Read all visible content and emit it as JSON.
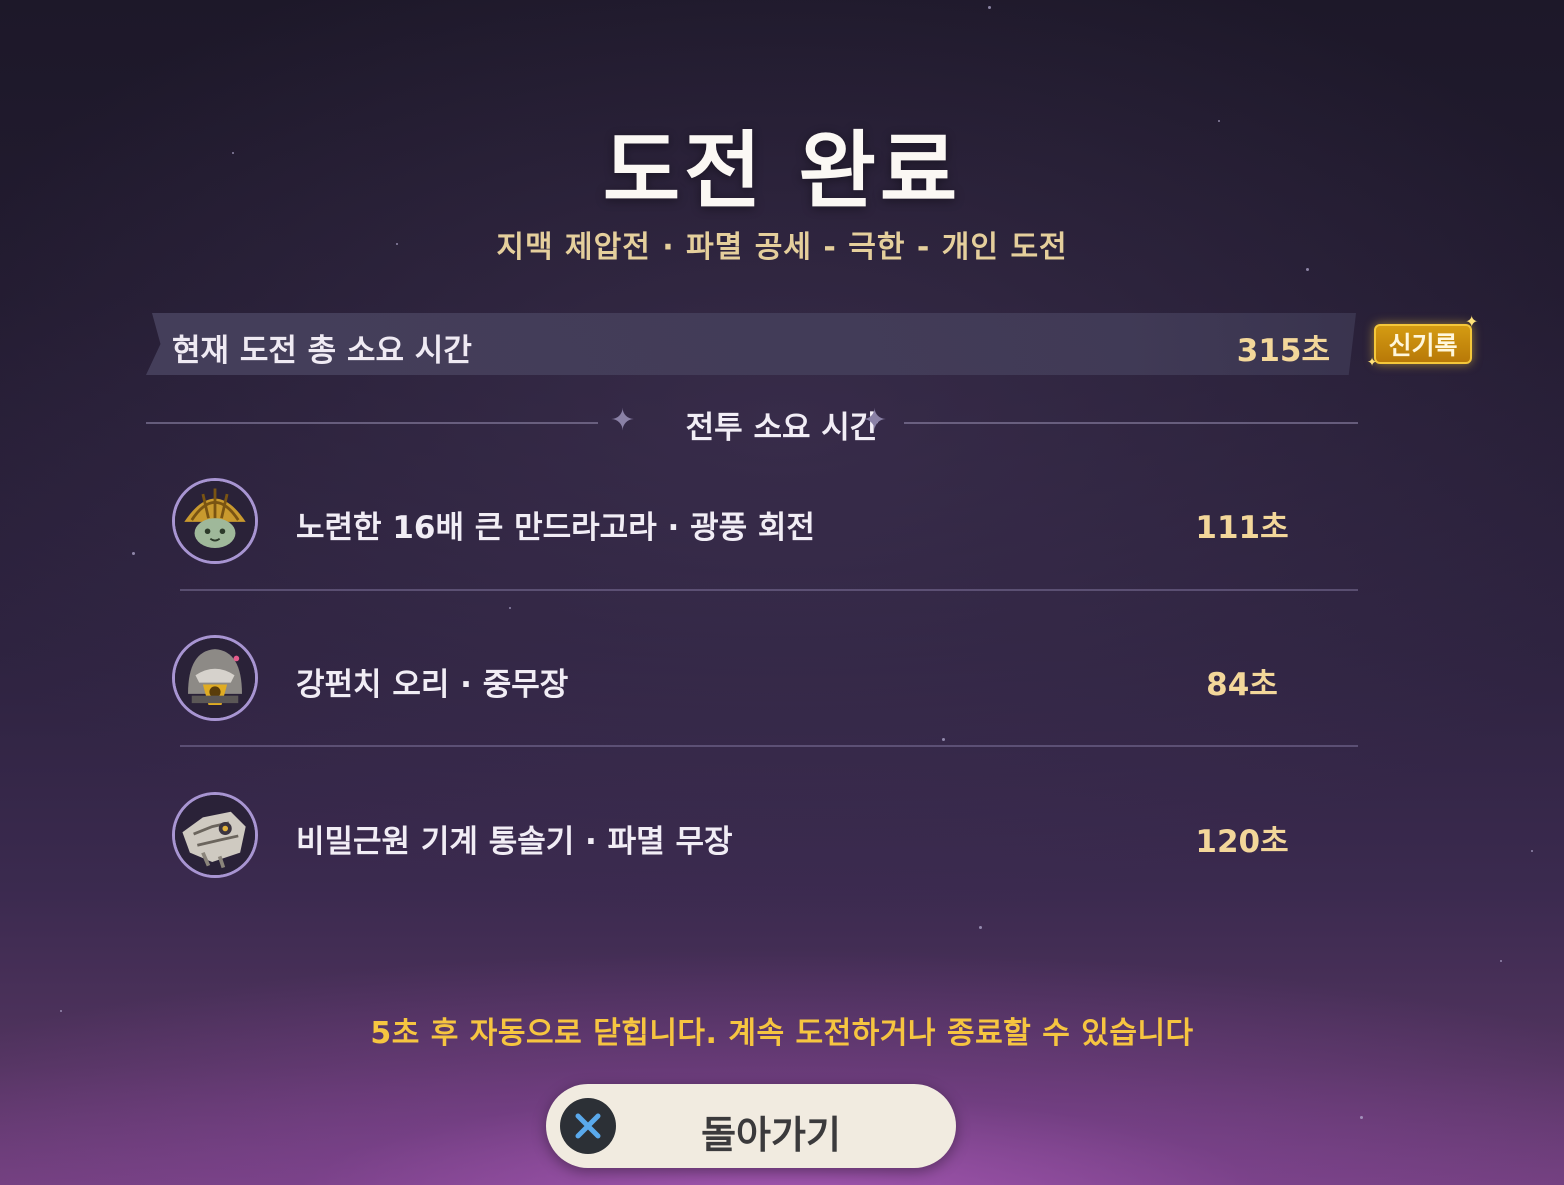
{
  "header": {
    "title": "도전 완료",
    "subtitle": "지맥 제압전 · 파멸 공세 - 극한 - 개인 도전"
  },
  "total": {
    "label": "현재 도전 총 소요 시간",
    "value": "315초",
    "badge": "신기록"
  },
  "section": {
    "title": "전투 소요 시간"
  },
  "battles": [
    {
      "name": "노련한 16배 큰 만드라고라 · 광풍 회전",
      "time": "111초",
      "icon": "mandragora-boss-icon"
    },
    {
      "name": "강펀치 오리 · 중무장",
      "time": "84초",
      "icon": "armored-duck-boss-icon"
    },
    {
      "name": "비밀근원 기계 통솔기 · 파멸 무장",
      "time": "120초",
      "icon": "secret-source-automaton-boss-icon"
    }
  ],
  "notice": "5초 후 자동으로 닫힙니다. 계속 도전하거나 종료할 수 있습니다",
  "back_button": {
    "label": "돌아가기",
    "icon": "close-x-icon"
  },
  "colors": {
    "accent_gold": "#f3d79a",
    "notice_yellow": "#f6c540",
    "badge_gold": "#d49b12"
  }
}
